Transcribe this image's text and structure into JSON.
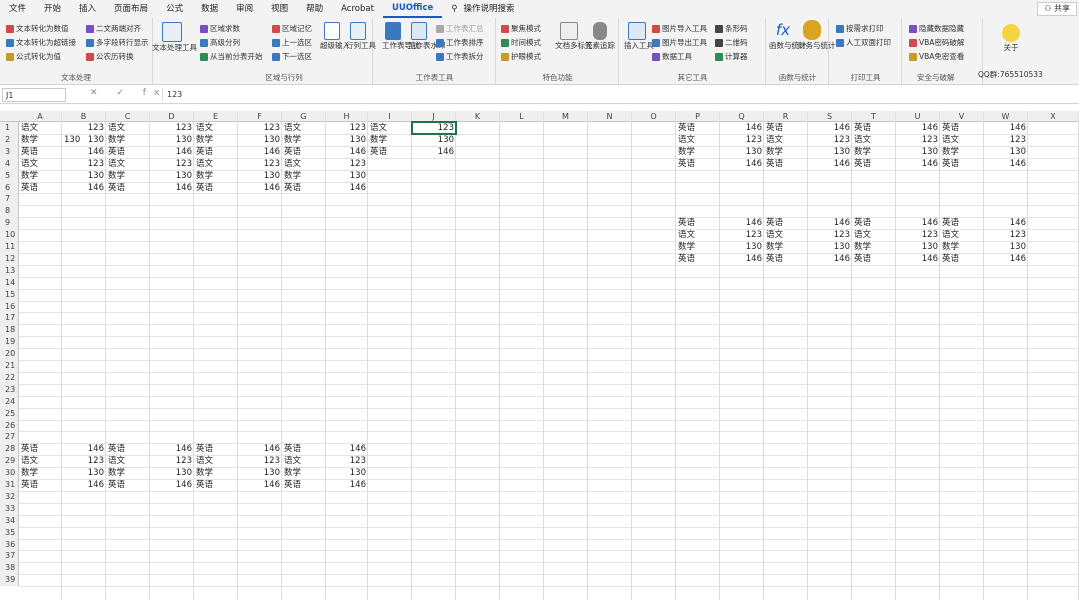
{
  "menu_tabs": [
    "文件",
    "开始",
    "插入",
    "页面布局",
    "公式",
    "数据",
    "审阅",
    "视图",
    "帮助",
    "Acrobat",
    "UUOffice",
    "操作说明搜索"
  ],
  "share_label": "共享",
  "ribbon": {
    "group_text": {
      "title": "文本处理",
      "items": [
        "文本转化为数值",
        "文本转化为超链接",
        "公式转化为值",
        "二文两端对齐",
        "多字段转行显示",
        "公农历转换"
      ],
      "big_label": "文本处理工具"
    },
    "group_region": {
      "title": "区域与行列",
      "items": [
        "区域求数",
        "高级分列",
        "从当前分表开始",
        "区域记忆",
        "上一选区",
        "下一选区"
      ],
      "big1": "超级输入",
      "big2": "行列工具"
    },
    "group_sheet": {
      "title": "工作表工具",
      "items": [
        "工作表汇总",
        "工作表排序",
        "工作表拆分"
      ],
      "big1": "工作表导航",
      "big2": "工作表水印"
    },
    "group_color": {
      "title": "特色功能",
      "items": [
        "聚焦模式",
        "时间模式",
        "护眼模式"
      ],
      "big1": "文档多标签",
      "big2": "元素追踪"
    },
    "group_other": {
      "title": "其它工具",
      "items": [
        "图片导入工具",
        "图片导出工具",
        "数据工具",
        "条形码",
        "二维码",
        "计算器"
      ],
      "big1": "插入工具"
    },
    "group_func": {
      "title": "函数与统计",
      "big1": "函数与统计",
      "big2": "财务与统计"
    },
    "group_print": {
      "title": "打印工具",
      "items": [
        "按需求打印",
        "人工双面打印"
      ]
    },
    "group_sec": {
      "title": "安全与破解",
      "items": [
        "隐藏数据隐藏",
        "VBA密码破解",
        "VBA免密查看"
      ],
      "extra": "QQ群:765510533"
    },
    "group_about": {
      "big1": "关于"
    }
  },
  "formula_bar": {
    "name_box": "J1",
    "value": "123",
    "icons": "✕ ✓ fx"
  },
  "columns": [
    "A",
    "B",
    "C",
    "D",
    "E",
    "F",
    "G",
    "H",
    "I",
    "J",
    "K",
    "L",
    "M",
    "N",
    "O",
    "P",
    "Q",
    "R",
    "S",
    "T",
    "U",
    "V",
    "W",
    "X"
  ],
  "rows": [
    "1",
    "2",
    "3",
    "4",
    "5",
    "6",
    "7",
    "8",
    "9",
    "10",
    "11",
    "12",
    "13",
    "14",
    "15",
    "16",
    "17",
    "18",
    "19",
    "20",
    "21",
    "22",
    "23",
    "24",
    "25",
    "26",
    "27",
    "28",
    "29",
    "30",
    "31",
    "32",
    "33",
    "34",
    "35",
    "36",
    "37",
    "38",
    "39"
  ],
  "cells": {
    "block1": [
      [
        "语文",
        "123",
        "语文",
        "123",
        "语文",
        "123",
        "语文",
        "123",
        "语文",
        "123"
      ],
      [
        "数学",
        "130",
        "数学",
        "130",
        "数学",
        "130",
        "数学",
        "130",
        "数学",
        "130"
      ],
      [
        "英语",
        "146",
        "英语",
        "146",
        "英语",
        "146",
        "英语",
        "146",
        "英语",
        "146"
      ],
      [
        "语文",
        "123",
        "语文",
        "123",
        "语文",
        "123",
        "语文",
        "123"
      ],
      [
        "数学",
        "130",
        "数学",
        "130",
        "数学",
        "130",
        "数学",
        "130"
      ],
      [
        "英语",
        "146",
        "英语",
        "146",
        "英语",
        "146",
        "英语",
        "146"
      ]
    ],
    "b2_value": "130",
    "block_right_top": [
      [
        "英语",
        "146",
        "英语",
        "146",
        "英语",
        "146",
        "英语",
        "146"
      ],
      [
        "语文",
        "123",
        "语文",
        "123",
        "语文",
        "123",
        "语文",
        "123"
      ],
      [
        "数学",
        "130",
        "数学",
        "130",
        "数学",
        "130",
        "数学",
        "130"
      ],
      [
        "英语",
        "146",
        "英语",
        "146",
        "英语",
        "146",
        "英语",
        "146"
      ]
    ],
    "block_right_bottom": [
      [
        "英语",
        "146",
        "英语",
        "146",
        "英语",
        "146",
        "英语",
        "146"
      ],
      [
        "语文",
        "123",
        "语文",
        "123",
        "语文",
        "123",
        "语文",
        "123"
      ],
      [
        "数学",
        "130",
        "数学",
        "130",
        "数学",
        "130",
        "数学",
        "130"
      ],
      [
        "英语",
        "146",
        "英语",
        "146",
        "英语",
        "146",
        "英语",
        "146"
      ]
    ],
    "block_bottom": [
      [
        "英语",
        "146",
        "英语",
        "146",
        "英语",
        "146",
        "英语",
        "146"
      ],
      [
        "语文",
        "123",
        "语文",
        "123",
        "语文",
        "123",
        "语文",
        "123"
      ],
      [
        "数学",
        "130",
        "数学",
        "130",
        "数学",
        "130",
        "数学",
        "130"
      ],
      [
        "英语",
        "146",
        "英语",
        "146",
        "英语",
        "146",
        "英语",
        "146"
      ]
    ]
  }
}
